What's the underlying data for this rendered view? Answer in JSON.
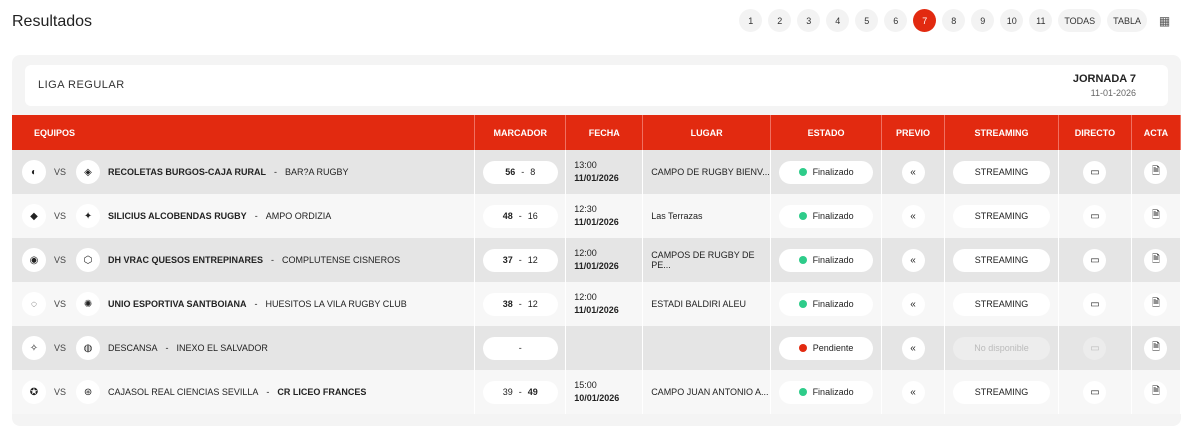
{
  "title": "Resultados",
  "pager": {
    "items": [
      "1",
      "2",
      "3",
      "4",
      "5",
      "6",
      "7",
      "8",
      "9",
      "10",
      "11",
      "TODAS",
      "TABLA"
    ],
    "active": "7"
  },
  "league": {
    "name": "LIGA REGULAR",
    "jornada": "JORNADA 7",
    "date": "11-01-2026"
  },
  "columns": [
    "EQUIPOS",
    "MARCADOR",
    "FECHA",
    "LUGAR",
    "ESTADO",
    "PREVIO",
    "STREAMING",
    "DIRECTO",
    "ACTA"
  ],
  "colors": {
    "accent": "#e22a10",
    "finalizado": "#2ecc8a",
    "pendiente": "#e22a10"
  },
  "matches": [
    {
      "home": "RECOLETAS BURGOS-CAJA RURAL",
      "away": "BAR?A RUGBY",
      "home_score": "56",
      "away_score": "8",
      "winner": "home",
      "time": "13:00",
      "date": "11/01/2026",
      "venue": "CAMPO DE RUGBY BIENV...",
      "status": "Finalizado",
      "streaming": "STREAMING"
    },
    {
      "home": "SILICIUS ALCOBENDAS RUGBY",
      "away": "AMPO ORDIZIA",
      "home_score": "48",
      "away_score": "16",
      "winner": "home",
      "time": "12:30",
      "date": "11/01/2026",
      "venue": "Las Terrazas",
      "status": "Finalizado",
      "streaming": "STREAMING"
    },
    {
      "home": "DH VRAC QUESOS ENTREPINARES",
      "away": "COMPLUTENSE CISNEROS",
      "home_score": "37",
      "away_score": "12",
      "winner": "home",
      "time": "12:00",
      "date": "11/01/2026",
      "venue": "CAMPOS DE RUGBY DE PE...",
      "status": "Finalizado",
      "streaming": "STREAMING"
    },
    {
      "home": "UNIO ESPORTIVA SANTBOIANA",
      "away": "HUESITOS LA VILA RUGBY CLUB",
      "home_score": "38",
      "away_score": "12",
      "winner": "home",
      "time": "12:00",
      "date": "11/01/2026",
      "venue": "ESTADI BALDIRI ALEU",
      "status": "Finalizado",
      "streaming": "STREAMING"
    },
    {
      "home": "DESCANSA",
      "away": "INEXO EL SALVADOR",
      "score_placeholder": "-",
      "winner": "none",
      "time": "",
      "date": "",
      "venue": "",
      "status": "Pendiente",
      "streaming": "No disponible"
    },
    {
      "home": "CAJASOL REAL CIENCIAS SEVILLA",
      "away": "CR LICEO FRANCES",
      "home_score": "39",
      "away_score": "49",
      "winner": "away",
      "time": "15:00",
      "date": "10/01/2026",
      "venue": "CAMPO JUAN ANTONIO A...",
      "status": "Finalizado",
      "streaming": "STREAMING"
    }
  ]
}
